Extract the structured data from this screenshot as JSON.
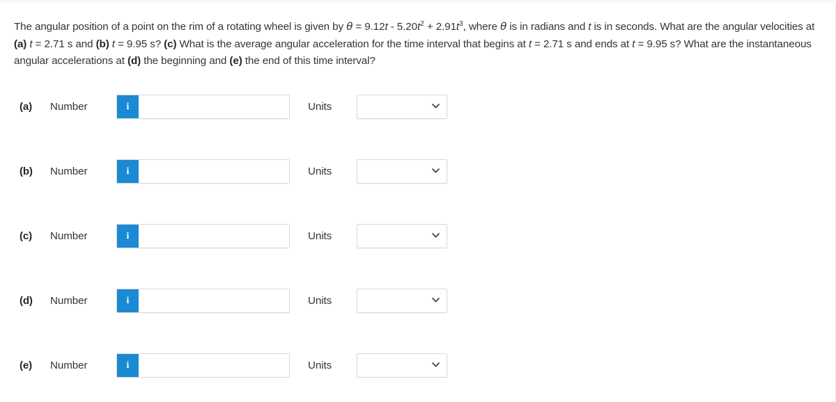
{
  "problem": {
    "text_part1": "The angular position of a point on the rim of a rotating wheel is given by ",
    "theta_symbol": "θ",
    "eq_equals": " = 9.12",
    "eq_t1": "t",
    "eq_minus": " - 5.20",
    "eq_t2": "t",
    "eq_sup2": "2",
    "eq_plus": " + 2.91",
    "eq_t3": "t",
    "eq_sup3": "3",
    "text_after_eq": ", where ",
    "theta_symbol2": "θ",
    "text_radians": " is in radians and ",
    "t_italic": "t",
    "text_is_in_seconds": " is in seconds. What are the angular velocities at ",
    "label_a": "(a)",
    "t_a": "t",
    "val_a": " = 2.71 s and ",
    "label_b": "(b)",
    "t_b": "t",
    "val_b": " = 9.95 s? ",
    "label_c": "(c)",
    "text_c": " What is the average angular acceleration for the time interval that begins at ",
    "t_c_start": "t",
    "val_c_start": " = 2.71 s and ends at ",
    "t_c_end": "t",
    "val_c_end": " = 9.95 s? What are the instantaneous angular accelerations at ",
    "label_d": "(d)",
    "text_d": " the beginning and ",
    "label_e": "(e)",
    "text_e": " the end of this time interval?"
  },
  "answers": {
    "number_label": "Number",
    "units_label": "Units",
    "info_icon_glyph": "i",
    "input_value": "",
    "input_placeholder": "",
    "select_value": "",
    "accent_color": "#1b8ad4",
    "rows": [
      {
        "id": "a",
        "label": "(a)"
      },
      {
        "id": "b",
        "label": "(b)"
      },
      {
        "id": "c",
        "label": "(c)"
      },
      {
        "id": "d",
        "label": "(d)"
      },
      {
        "id": "e",
        "label": "(e)"
      }
    ]
  }
}
